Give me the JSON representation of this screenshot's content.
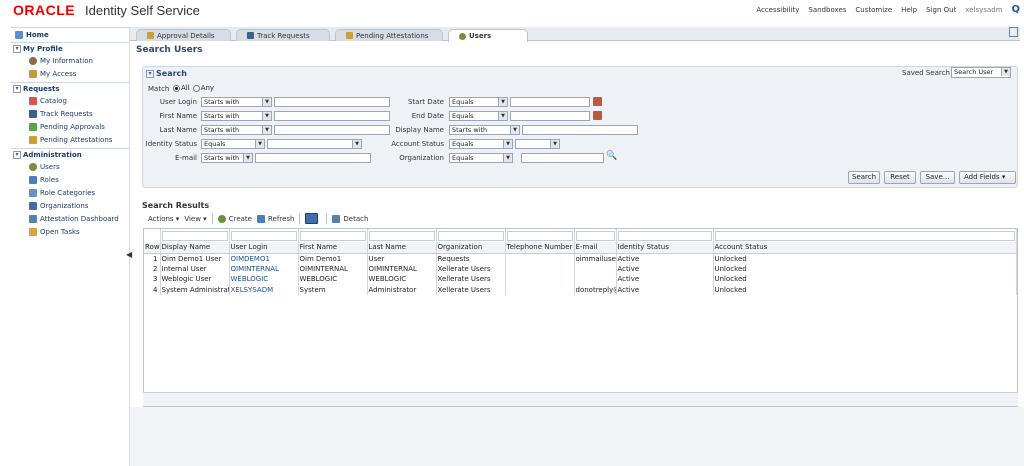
{
  "header": {
    "logo": "ORACLE",
    "product": "Identity Self Service",
    "links": [
      "Accessibility",
      "Sandboxes",
      "Customize",
      "Help",
      "Sign Out"
    ],
    "user": "xelsysadm"
  },
  "sidebar": {
    "home": "Home",
    "sections": [
      {
        "label": "My Profile",
        "items": [
          "My Information",
          "My Access"
        ]
      },
      {
        "label": "Requests",
        "items": [
          "Catalog",
          "Track Requests",
          "Pending Approvals",
          "Pending Attestations"
        ]
      },
      {
        "label": "Administration",
        "items": [
          "Users",
          "Roles",
          "Role Categories",
          "Organizations",
          "Attestation Dashboard",
          "Open Tasks"
        ]
      }
    ]
  },
  "tabs": [
    "Approval Details",
    "Track Requests",
    "Pending Attestations",
    "Users"
  ],
  "page_title": "Search Users",
  "search": {
    "title": "Search",
    "saved_search_label": "Saved Search",
    "saved_search_value": "Search User",
    "match_label": "Match",
    "match_all": "All",
    "match_any": "Any",
    "left_fields": [
      {
        "label": "User Login",
        "op": "Starts with"
      },
      {
        "label": "First Name",
        "op": "Starts with"
      },
      {
        "label": "Last Name",
        "op": "Starts with"
      },
      {
        "label": "Identity Status",
        "op": "Equals"
      },
      {
        "label": "E-mail",
        "op": "Starts with"
      }
    ],
    "right_fields": [
      {
        "label": "Start Date",
        "op": "Equals"
      },
      {
        "label": "End Date",
        "op": "Equals"
      },
      {
        "label": "Display Name",
        "op": "Starts with"
      },
      {
        "label": "Account Status",
        "op": "Equals"
      },
      {
        "label": "Organization",
        "op": "Equals"
      }
    ],
    "buttons": [
      "Search",
      "Reset",
      "Save...",
      "Add Fields"
    ]
  },
  "results": {
    "title": "Search Results",
    "toolbar": {
      "actions": "Actions",
      "view": "View",
      "create": "Create",
      "refresh": "Refresh",
      "detach": "Detach"
    },
    "columns": [
      "Row",
      "Display Name",
      "User Login",
      "First Name",
      "Last Name",
      "Organization",
      "Telephone Number",
      "E-mail",
      "Identity Status",
      "Account Status"
    ],
    "rows": [
      [
        "1",
        "Oim Demo1 User",
        "OIMDEMO1",
        "Oim Demo1",
        "User",
        "Requests",
        "",
        "oimmailuser@",
        "Active",
        "Unlocked"
      ],
      [
        "2",
        "Internal User",
        "OIMINTERNAL",
        "OIMINTERNAL",
        "OIMINTERNAL",
        "Xellerate Users",
        "",
        "",
        "Active",
        "Unlocked"
      ],
      [
        "3",
        "Weblogic User",
        "WEBLOGIC",
        "WEBLOGIC",
        "WEBLOGIC",
        "Xellerate Users",
        "",
        "",
        "Active",
        "Unlocked"
      ],
      [
        "4",
        "System Administrator",
        "XELSYSADM",
        "System",
        "Administrator",
        "Xellerate Users",
        "",
        "donotreply@",
        "Active",
        "Unlocked"
      ]
    ]
  }
}
